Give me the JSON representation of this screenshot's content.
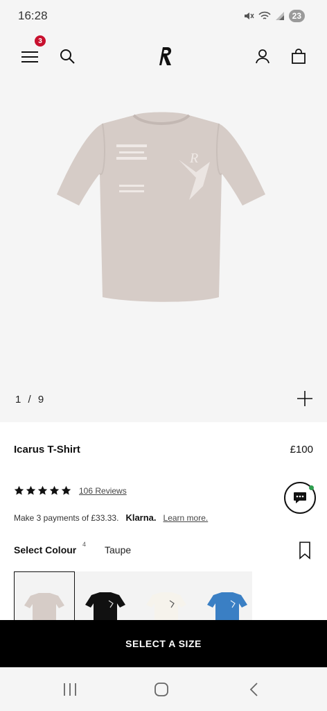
{
  "status_bar": {
    "time": "16:28",
    "battery": "23",
    "icons": [
      "mute-icon",
      "wifi-icon",
      "signal-icon",
      "battery-icon"
    ]
  },
  "header": {
    "menu_badge": "3",
    "icons": [
      "hamburger-menu-icon",
      "search-icon",
      "brand-logo",
      "account-icon",
      "shopping-bag-icon"
    ]
  },
  "gallery": {
    "current": "1",
    "separator": "/",
    "total": "9",
    "image_alt_color": "#d4c9c4"
  },
  "product": {
    "name": "Icarus T-Shirt",
    "price": "£100",
    "rating_stars": 5,
    "reviews_label": "106 Reviews"
  },
  "klarna": {
    "text": "Make 3 payments of £33.33.",
    "logo": "Klarna.",
    "learn_more": "Learn more."
  },
  "colour": {
    "label": "Select Colour",
    "count": "4",
    "selected": "Taupe",
    "swatches": [
      {
        "name": "Taupe",
        "color": "#d4c9c4"
      },
      {
        "name": "Black",
        "color": "#111111"
      },
      {
        "name": "White",
        "color": "#f4f1ea"
      },
      {
        "name": "Blue",
        "color": "#3a7fc4"
      }
    ]
  },
  "cta": {
    "label": "SELECT A SIZE"
  },
  "colors": {
    "badge": "#c8102e",
    "cta_background": "#000000",
    "chat_status": "#2e9e4f"
  }
}
